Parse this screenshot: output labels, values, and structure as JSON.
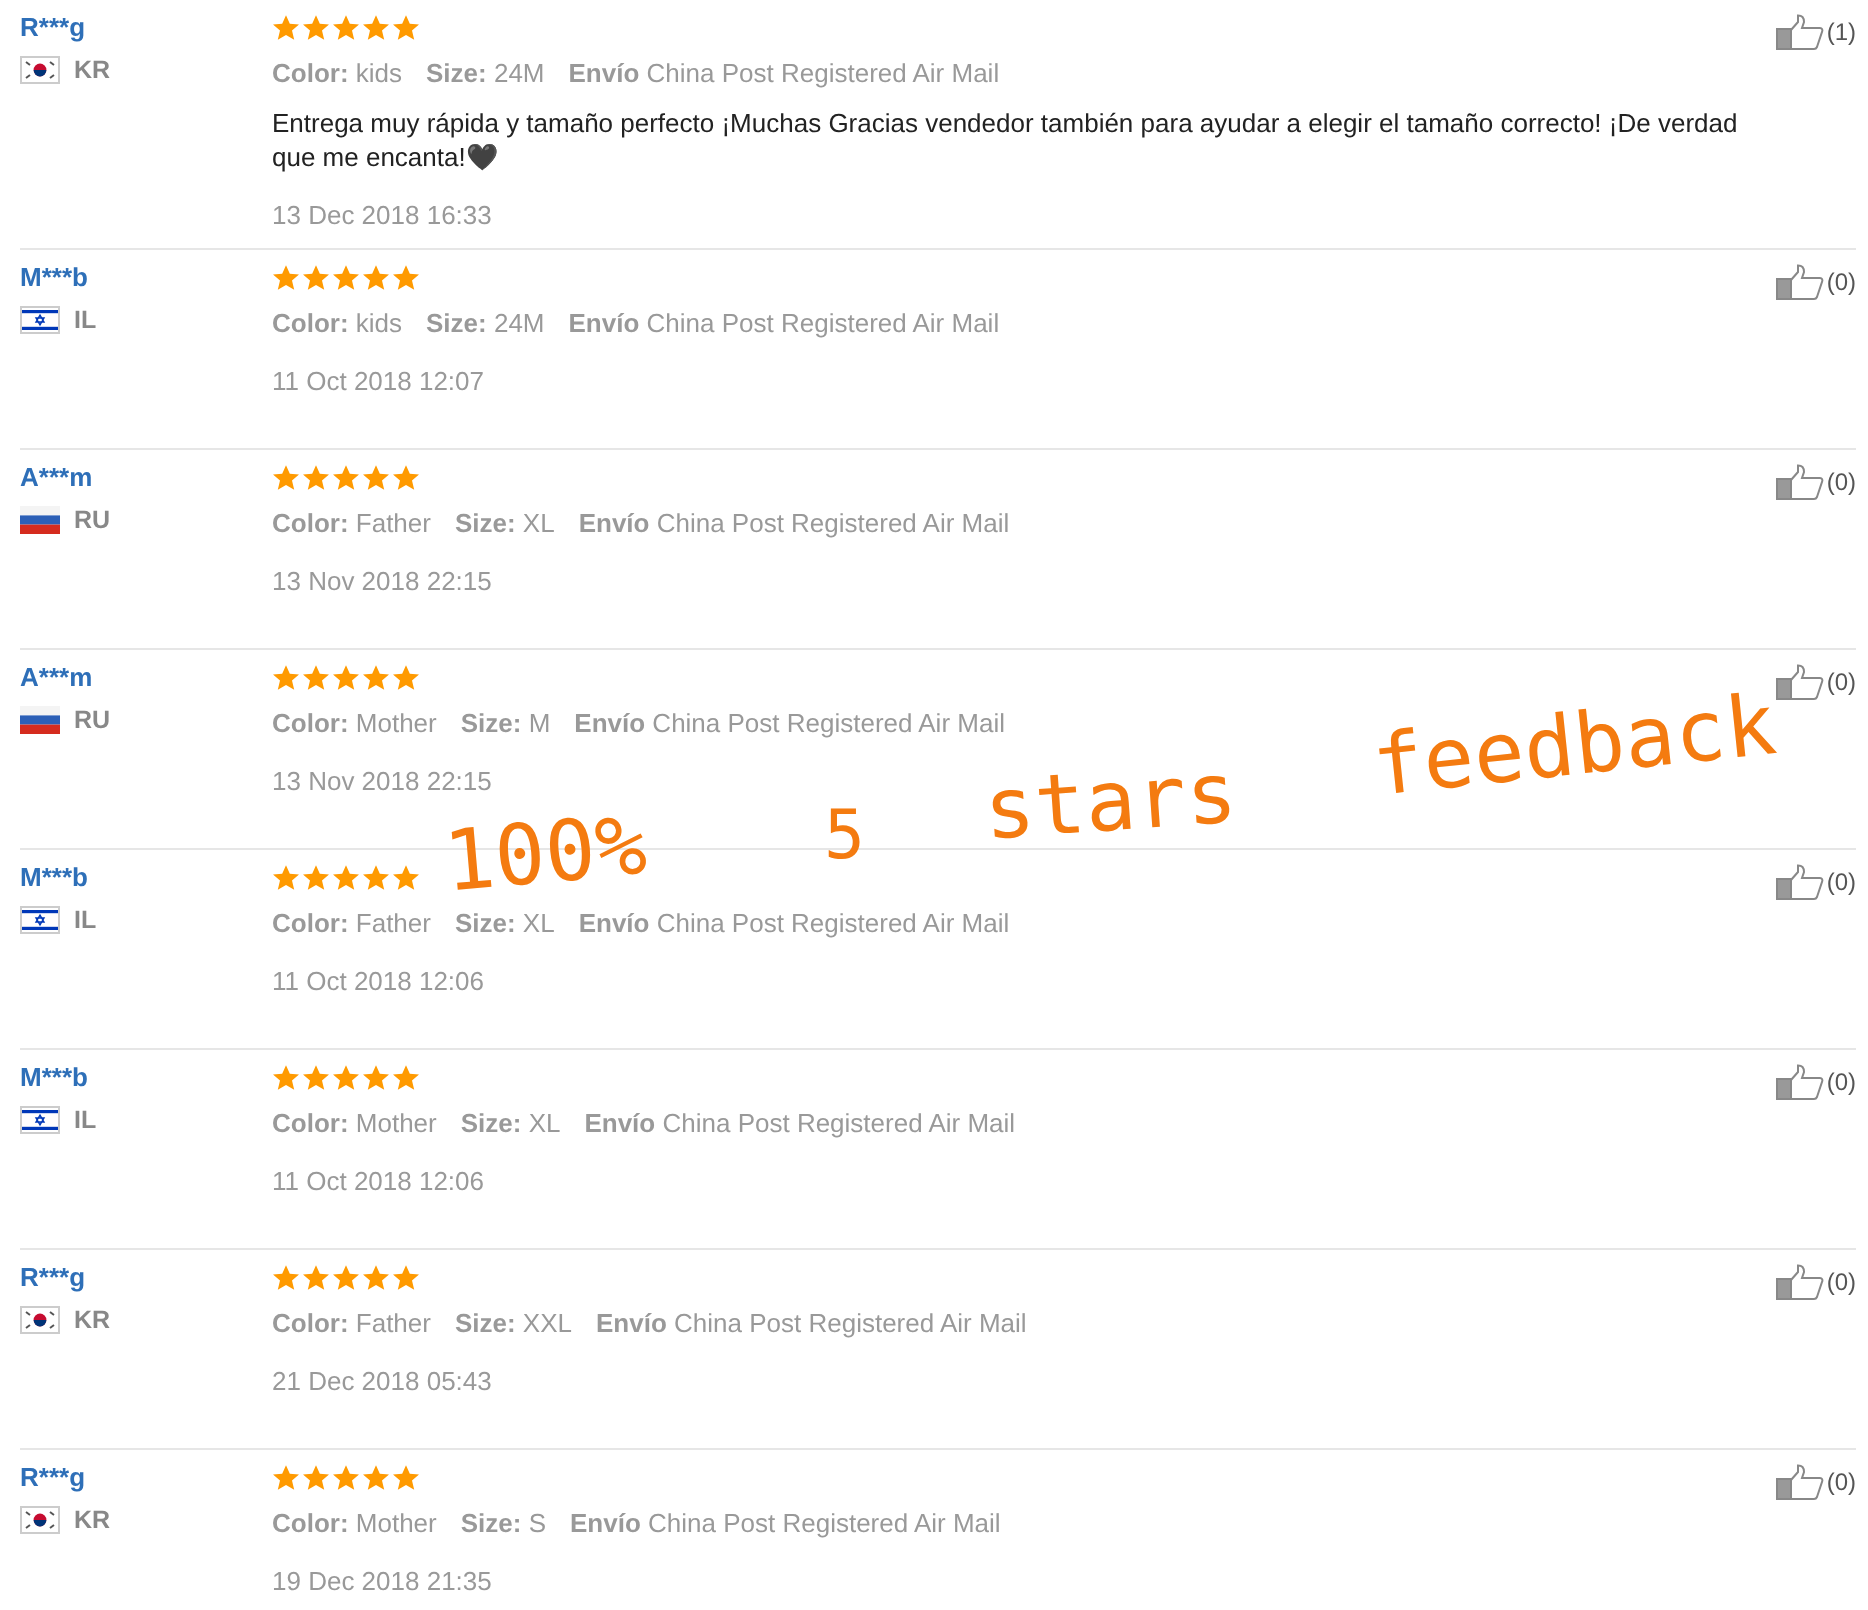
{
  "reviews": [
    {
      "user": "R***g",
      "kind": "kr",
      "country": "KR",
      "stars": 5,
      "attributes": [
        "**Color:** kids",
        "**Size:** 24M",
        "**Envío** China Post Registered Air Mail"
      ],
      "comment": "Entrega muy rápida y tamaño perfecto ¡Muchas Gracias vendedor también para ayudar a elegir el tamaño correcto! ¡De verdad que me encanta!🖤",
      "date": "13 Dec 2018 16:33",
      "likes": "(1)"
    },
    {
      "user": "M***b",
      "kind": "il",
      "country": "IL",
      "stars": 5,
      "attributes": [
        "**Color:** kids",
        "**Size:** 24M",
        "**Envío** China Post Registered Air Mail"
      ],
      "date": "11 Oct 2018 12:07",
      "likes": "(0)"
    },
    {
      "user": "A***m",
      "kind": "ru",
      "country": "RU",
      "stars": 5,
      "attributes": [
        "**Color:** Father",
        "**Size:** XL",
        "**Envío** China Post Registered Air Mail"
      ],
      "date": "13 Nov 2018 22:15",
      "likes": "(0)"
    },
    {
      "user": "A***m",
      "kind": "ru",
      "country": "RU",
      "stars": 5,
      "attributes": [
        "**Color:** Mother",
        "**Size:** M",
        "**Envío** China Post Registered Air Mail"
      ],
      "date": "13 Nov 2018 22:15",
      "likes": "(0)"
    },
    {
      "user": "M***b",
      "kind": "il",
      "country": "IL",
      "stars": 5,
      "attributes": [
        "**Color:** Father",
        "**Size:** XL",
        "**Envío** China Post Registered Air Mail"
      ],
      "date": "11 Oct 2018 12:06",
      "likes": "(0)"
    },
    {
      "user": "M***b",
      "kind": "il",
      "country": "IL",
      "stars": 5,
      "attributes": [
        "**Color:** Mother",
        "**Size:** XL",
        "**Envío** China Post Registered Air Mail"
      ],
      "date": "11 Oct 2018 12:06",
      "likes": "(0)"
    },
    {
      "user": "R***g",
      "kind": "kr",
      "country": "KR",
      "stars": 5,
      "attributes": [
        "**Color:** Father",
        "**Size:** XXL",
        "**Envío** China Post Registered Air Mail"
      ],
      "date": "21 Dec 2018 05:43",
      "likes": "(0)"
    },
    {
      "user": "R***g",
      "kind": "kr",
      "country": "KR",
      "stars": 5,
      "attributes": [
        "**Color:** Mother",
        "**Size:** S",
        "**Envío** China Post Registered Air Mail"
      ],
      "date": "19 Dec 2018 21:35",
      "likes": "(0)"
    }
  ],
  "annotation": [
    "100%",
    "5",
    "stars",
    "feedback"
  ]
}
